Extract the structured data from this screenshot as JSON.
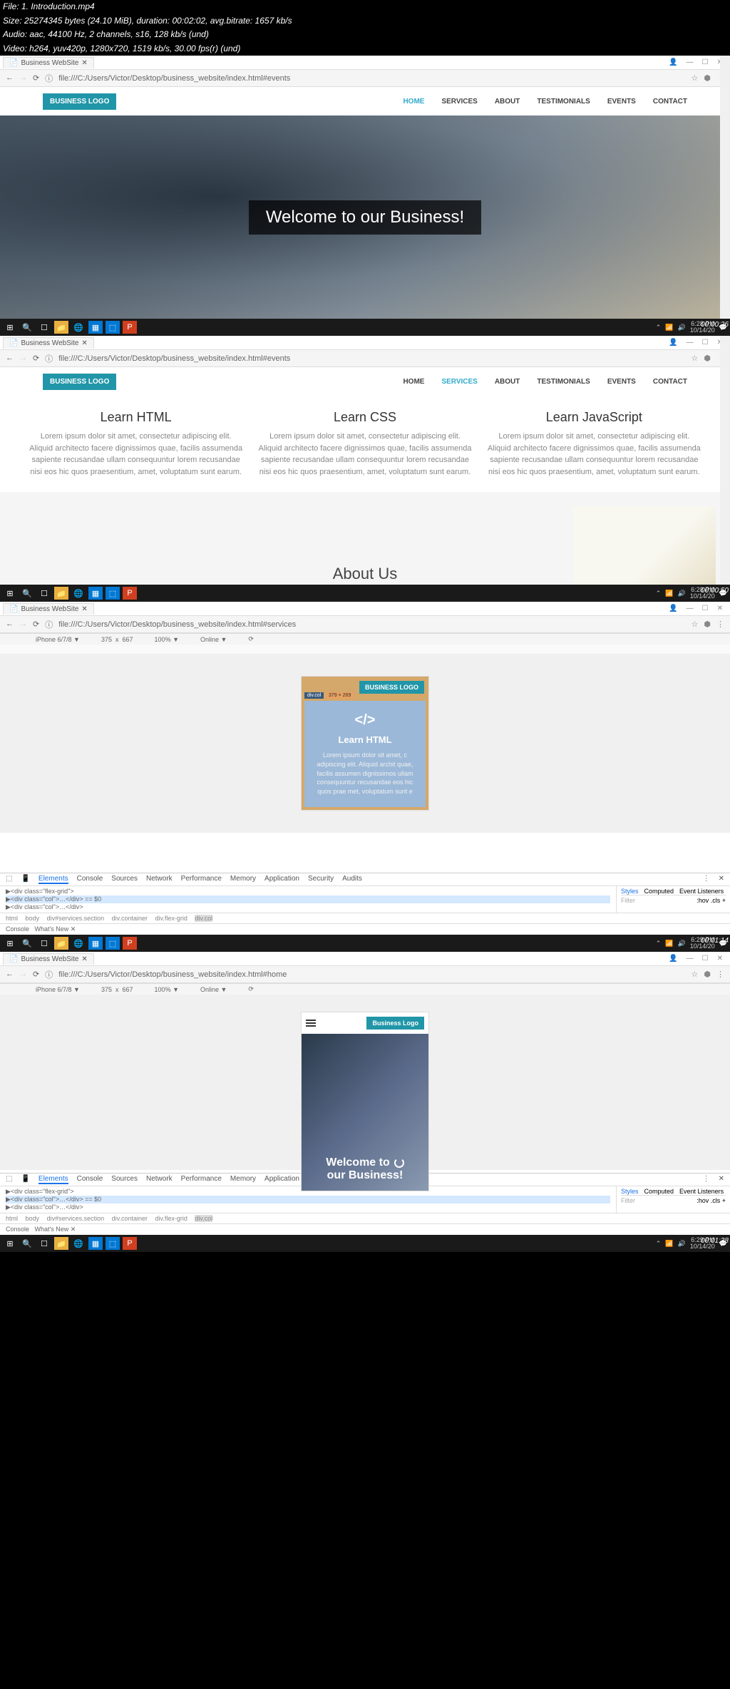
{
  "meta": {
    "file": "File: 1. Introduction.mp4",
    "size": "Size: 25274345 bytes (24.10 MiB), duration: 00:02:02, avg.bitrate: 1657 kb/s",
    "audio": "Audio: aac, 44100 Hz, 2 channels, s16, 128 kb/s (und)",
    "video": "Video: h264, yuv420p, 1280x720, 1519 kb/s, 30.00 fps(r) (und)"
  },
  "tab_title": "Business WebSite",
  "urls": {
    "s1": "file:///C:/Users/Victor/Desktop/business_website/index.html#events",
    "s2": "file:///C:/Users/Victor/Desktop/business_website/index.html#events",
    "s3": "file:///C:/Users/Victor/Desktop/business_website/index.html#services",
    "s4": "file:///C:/Users/Victor/Desktop/business_website/index.html#home"
  },
  "nav": {
    "logo": "BUSINESS LOGO",
    "items": [
      "HOME",
      "SERVICES",
      "ABOUT",
      "TESTIMONIALS",
      "EVENTS",
      "CONTACT"
    ]
  },
  "hero": "Welcome to our Business!",
  "services": [
    {
      "title": "Learn HTML",
      "desc": "Lorem ipsum dolor sit amet, consectetur adipiscing elit. Aliquid architecto facere dignissimos quae, facilis assumenda sapiente recusandae ullam consequuntur lorem recusandae nisi eos hic quos praesentium, amet, voluptatum sunt earum."
    },
    {
      "title": "Learn CSS",
      "desc": "Lorem ipsum dolor sit amet, consectetur adipiscing elit. Aliquid architecto facere dignissimos quae, facilis assumenda sapiente recusandae ullam consequuntur lorem recusandae nisi eos hic quos praesentium, amet, voluptatum sunt earum."
    },
    {
      "title": "Learn JavaScript",
      "desc": "Lorem ipsum dolor sit amet, consectetur adipiscing elit. Aliquid architecto facere dignissimos quae, facilis assumenda sapiente recusandae ullam consequuntur lorem recusandae nisi eos hic quos praesentium, amet, voluptatum sunt earum."
    }
  ],
  "about": "About Us",
  "devtoolbar": {
    "device": "iPhone 6/7/8 ▼",
    "w": "375",
    "x": "x",
    "h": "667",
    "zoom": "100% ▼",
    "online": "Online ▼"
  },
  "mobile": {
    "logo": "BUSINESS LOGO",
    "logo2": "Business Logo",
    "card_badge1": "div.col",
    "card_badge2": "379 × 269",
    "card_title": "Learn HTML",
    "card_desc": "Lorem ipsum dolor sit amet, c adipiscing elit. Aliquid archit quae, facilis assumen dignissimos ullam consequuntur recusandae eos hic quos prae met, voluptatum sunt e",
    "hero1": "Welcome to",
    "hero2": "our Business!"
  },
  "devtools": {
    "tabs": [
      "Elements",
      "Console",
      "Sources",
      "Network",
      "Performance",
      "Memory",
      "Application",
      "Security",
      "Audits"
    ],
    "code1": "▶<div class=\"flex-grid\">",
    "code2": "  ▶<div class=\"col\">…</div> == $0",
    "code3": "  ▶<div class=\"col\">…</div>",
    "bc3": [
      "html",
      "body",
      "div#services.section",
      "div.container",
      "div.flex-grid",
      "div.col"
    ],
    "bc4": [
      "html",
      "body",
      "div#services.section",
      "div.container",
      "div.flex-grid",
      "div.col"
    ],
    "side_tabs": [
      "Styles",
      "Computed",
      "Event Listeners"
    ],
    "filter": "Filter",
    "hov": ":hov .cls +",
    "console": "Console",
    "whatsnew": "What's New ✕"
  },
  "clock": {
    "t1": "6:28 PM",
    "d1": "10/14/20",
    "t2": "6:28 PM",
    "t3": "6:29 PM",
    "t4": "6:29 PM"
  },
  "stamps": {
    "s1": "00:00:26",
    "s2": "00:00:50",
    "s3": "00:01:14",
    "s4": "00:01:38"
  }
}
